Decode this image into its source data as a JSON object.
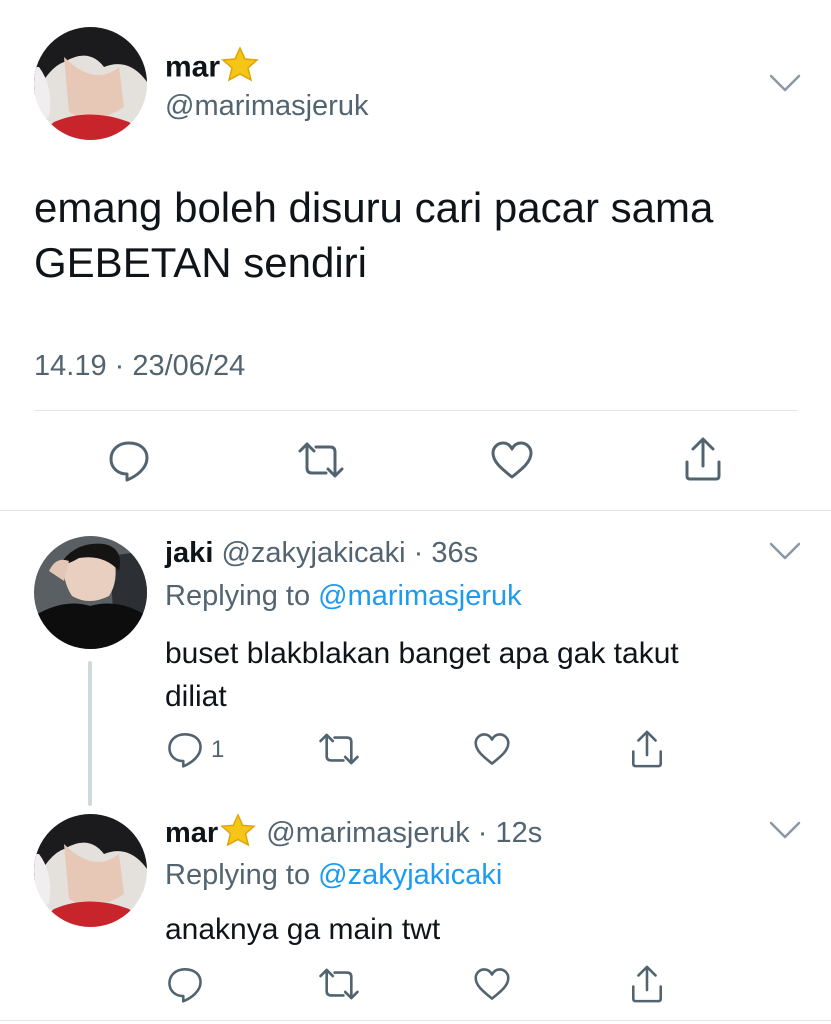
{
  "main_tweet": {
    "display_name": "mar",
    "handle": "@marimasjeruk",
    "text_line1": "emang boleh disuru cari pacar sama",
    "text_line2": "GEBETAN sendiri",
    "timestamp": "14.19 · 23/06/24"
  },
  "reply1": {
    "display_name": "jaki",
    "handle": "@zakyjakicaki",
    "time": "· 36s",
    "replying_prefix": "Replying to",
    "replying_to": "@marimasjeruk",
    "text_line1": "buset blakblakan banget apa gak takut",
    "text_line2": "diliat",
    "reply_count": "1"
  },
  "reply2": {
    "display_name": "mar",
    "handle": "@marimasjeruk",
    "time": "· 12s",
    "replying_prefix": "Replying to",
    "replying_to": "@zakyjakicaki",
    "text": "anaknya ga main twt"
  },
  "icons": {
    "reply": "reply-icon",
    "retweet": "retweet-icon",
    "like": "heart-icon",
    "share": "share-icon",
    "more": "chevron-down-icon",
    "badge": "star-icon"
  },
  "colors": {
    "text": "#0f1419",
    "secondary": "#536471",
    "link": "#1d9bf0",
    "star": "#f5c518"
  }
}
